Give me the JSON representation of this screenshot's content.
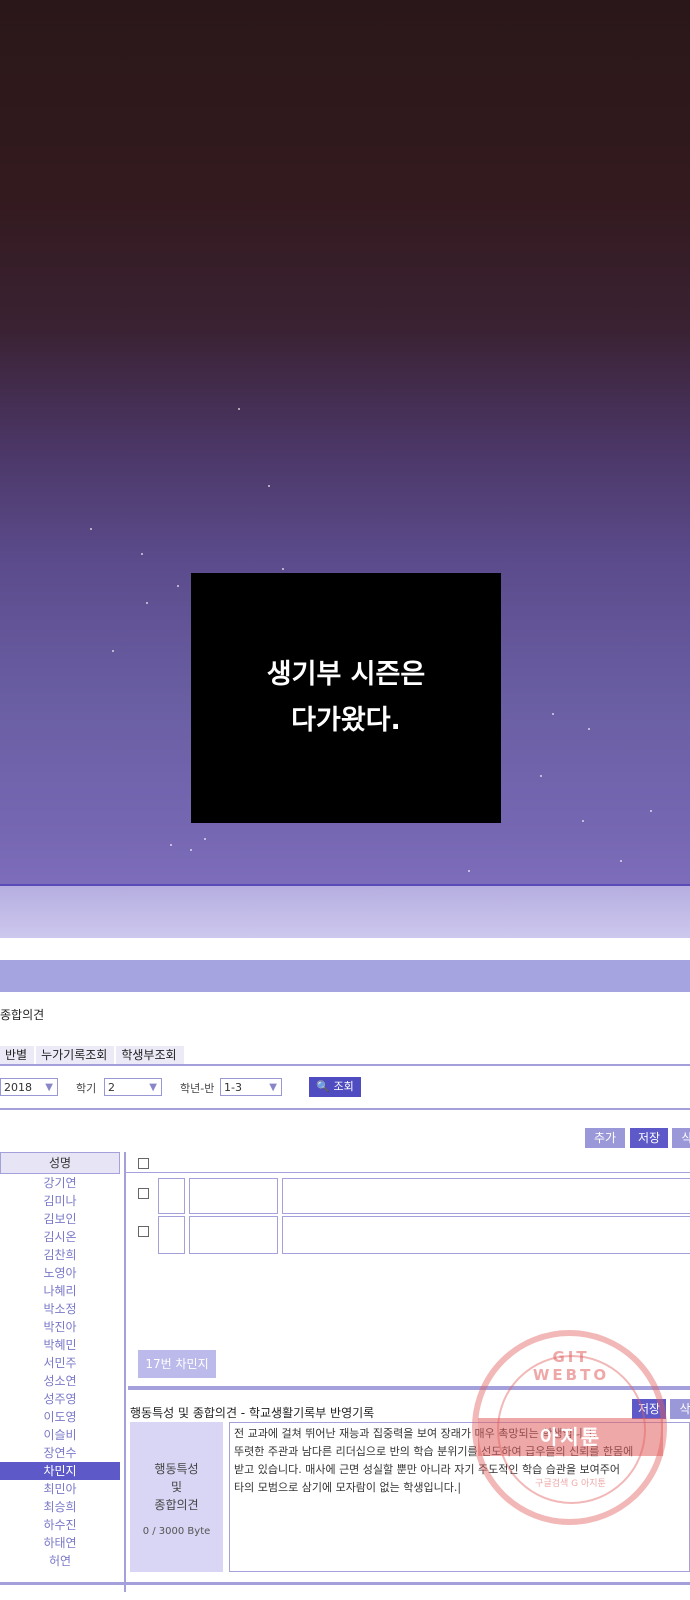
{
  "caption": {
    "line1": "생기부 시즌은",
    "line2": "다가왔다."
  },
  "app": {
    "title": "종합의견",
    "tabs": [
      "반별",
      "누가기록조회",
      "학생부조회"
    ],
    "filters": {
      "year": "2018",
      "semester_label": "학기",
      "semester": "2",
      "class_label": "학년-반",
      "class": "1-3",
      "search_label": "조회"
    },
    "buttons": {
      "add": "추가",
      "save": "저장",
      "delete": "삭"
    },
    "names_header": "성명",
    "names": [
      "강기연",
      "김미나",
      "김보인",
      "김시온",
      "김찬희",
      "노영아",
      "나혜리",
      "박소정",
      "박진아",
      "박혜민",
      "서민주",
      "성소연",
      "성주영",
      "이도영",
      "이슬비",
      "장연수",
      "차민지",
      "최민아",
      "최승희",
      "하수진",
      "하태연",
      "허연"
    ],
    "selected_name": "차민지",
    "selected_student": "17번 차민지",
    "section_title": "행동특성 및 종합의견 - 학교생활기록부 반영기록",
    "section_save": "저장",
    "section_delete": "삭",
    "side_label": "행동특성\n및\n종합의견",
    "byte_count": "0 / 3000 Byte",
    "comment_lines": [
      "전 교과에 걸쳐 뛰어난 재능과 집중력을 보여 장래가 매우 촉망되는 학생입니다.",
      "뚜렷한 주관과 남다른 리더십으로 반의 학습 분위기를 선도하여 급우들의 신뢰를 한몸에",
      "받고 있습니다. 매사에 근면 성실할 뿐만 아니라 자기 주도적인 학습 습관을 보여주어",
      "타의 모범으로 삼기에 모자람이 없는 학생입니다.|"
    ]
  },
  "watermark": {
    "top": "GIT WEBTO",
    "band": "아지툰",
    "bottom": "구글검색 G 아지툰"
  },
  "colors": {
    "accent": "#5d59c8",
    "light_accent": "#a6a4e0",
    "stamp": "#e26060"
  }
}
